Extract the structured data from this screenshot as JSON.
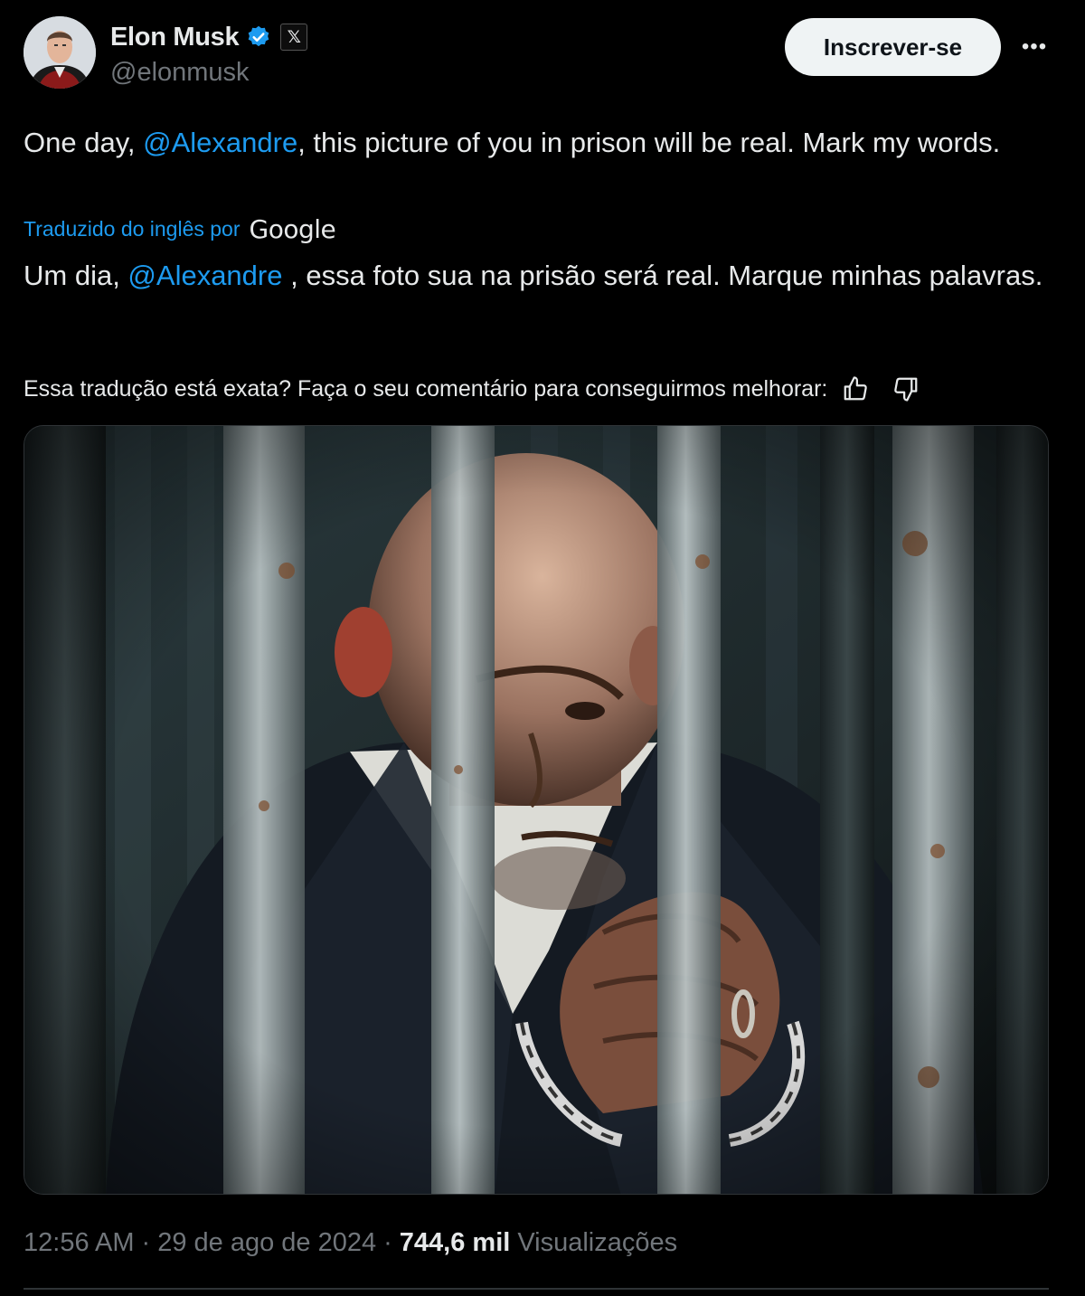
{
  "author": {
    "display_name": "Elon Musk",
    "handle": "@elonmusk",
    "verified_icon": "verified-badge-icon",
    "affiliation_icon": "x-logo-icon",
    "affiliation_glyph": "𝕏"
  },
  "actions": {
    "subscribe_label": "Inscrever-se",
    "more_label": "•••"
  },
  "tweet": {
    "text_before_mention": "One day, ",
    "mention": "@Alexandre",
    "text_after_mention": ", this picture of you in prison will be real. Mark my words."
  },
  "translation": {
    "label": "Traduzido do inglês por",
    "provider": "Google",
    "text_before_mention": "Um dia, ",
    "mention": "@Alexandre",
    "text_after_mention": " , essa foto sua na prisão será real. Marque minhas palavras.",
    "feedback_prompt": "Essa tradução está exata? Faça o seu comentário para conseguirmos melhorar:",
    "thumbs_up_icon": "thumbs-up-icon",
    "thumbs_down_icon": "thumbs-down-icon"
  },
  "meta": {
    "time": "12:56 AM",
    "separator": "·",
    "date": "29 de ago de 2024",
    "views_count": "744,6 mil",
    "views_label": "Visualizações"
  },
  "colors": {
    "background": "#000000",
    "text": "#e7e9ea",
    "secondary": "#71767b",
    "link": "#1d9bf0",
    "button_bg": "#eff3f4"
  }
}
